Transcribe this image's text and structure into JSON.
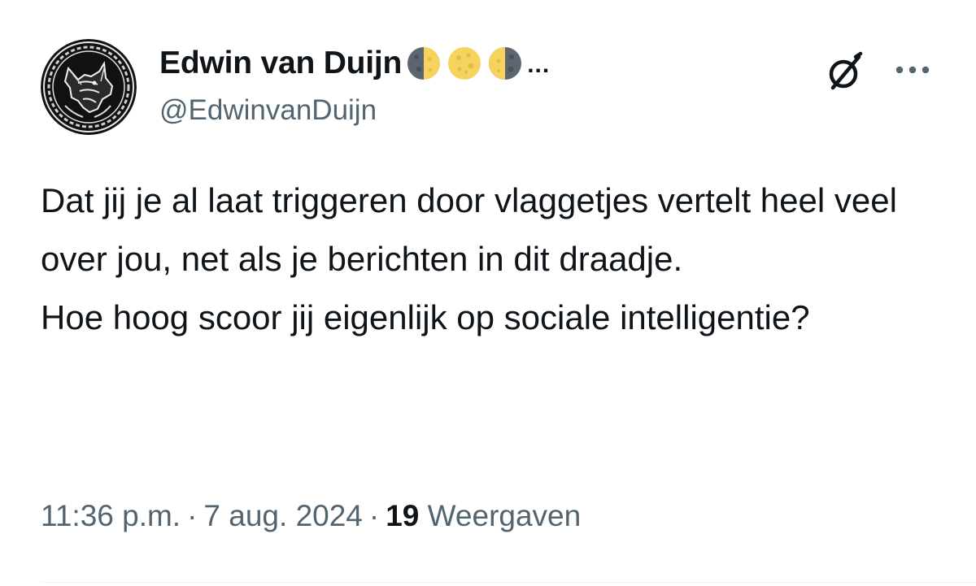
{
  "tweet": {
    "author": {
      "display_name": "Edwin van Duijn",
      "name_emojis": [
        "last-quarter-moon-icon",
        "full-moon-icon",
        "first-quarter-moon-icon"
      ],
      "truncation": "...",
      "handle": "@EdwinvanDuijn",
      "avatar_icon": "celtic-wolf-avatar"
    },
    "actions": {
      "grok_icon": "grok-icon",
      "more_icon": "more-options-icon"
    },
    "text": {
      "paragraph_1": "Dat jij je al laat triggeren door vlaggetjes vertelt heel veel over jou, net als je berichten in dit draadje.",
      "paragraph_2": "Hoe hoog scoor jij eigenlijk op sociale intelligentie?"
    },
    "meta": {
      "time": "11:36 p.m.",
      "separator": "·",
      "date": "7 aug. 2024",
      "views_count": "19",
      "views_label": "Weergaven"
    }
  },
  "colors": {
    "primary_text": "#0f1419",
    "secondary_text": "#536471",
    "divider": "#eff3f4"
  }
}
